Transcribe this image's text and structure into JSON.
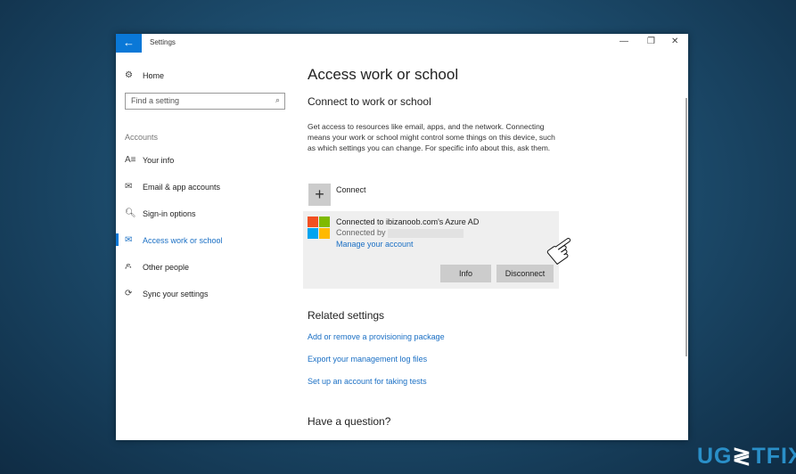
{
  "window": {
    "title": "Settings",
    "controls": [
      "—",
      "❐",
      "✕"
    ]
  },
  "sidebar": {
    "home": "Home",
    "search_placeholder": "Find a setting",
    "section": "Accounts",
    "items": [
      {
        "label": "Your info",
        "icon": "A≡"
      },
      {
        "label": "Email & app accounts",
        "icon": "✉"
      },
      {
        "label": "Sign-in options",
        "icon": "🔍︎"
      },
      {
        "label": "Access work or school",
        "icon": "✉",
        "active": true
      },
      {
        "label": "Other people",
        "icon": "ዶ"
      },
      {
        "label": "Sync your settings",
        "icon": "⟳"
      }
    ]
  },
  "main": {
    "title": "Access work or school",
    "subtitle": "Connect to work or school",
    "description": "Get access to resources like email, apps, and the network. Connecting means your work or school might control some things on this device, such as which settings you can change. For specific info about this, ask them.",
    "connect": "Connect",
    "account": {
      "name": "Connected to ibizanoob.com's Azure AD",
      "by": "Connected by",
      "manage": "Manage your account",
      "info": "Info",
      "disconnect": "Disconnect"
    },
    "related_title": "Related settings",
    "related": [
      "Add or remove a provisioning package",
      "Export your management log files",
      "Set up an account for taking tests"
    ],
    "question": "Have a question?"
  },
  "watermark": "UG≷TFIX",
  "colors": {
    "accent": "#0a78d7",
    "link": "#1a6fc4"
  }
}
